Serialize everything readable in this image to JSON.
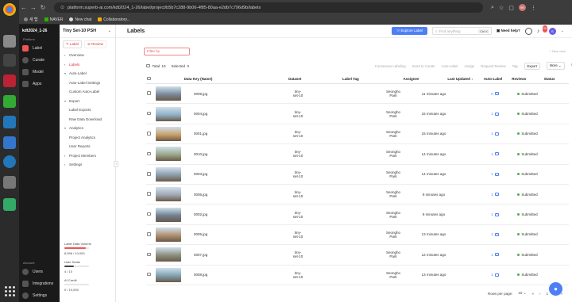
{
  "browser": {
    "url": "platform.superb-ai.com/kdt2024_1-26/label/project/b5b7c288-9b06-4f85-80aa-e2db7c796d9b/labels",
    "bookmarks": [
      "새 탭",
      "NAVER",
      "New chat",
      "Collaboratory..."
    ],
    "avatar": "99"
  },
  "appnav": {
    "workspace": "kdt2024_1-26",
    "platform_section": "Platform",
    "items": [
      "Label",
      "Curate",
      "Model",
      "Apps"
    ],
    "account_section": "Account",
    "bottom_items": [
      "Users",
      "Integrations",
      "Settings"
    ]
  },
  "project": {
    "name": "Tiny Set-10 PSH",
    "tabs": [
      "Label",
      "Review"
    ],
    "menu": [
      {
        "label": "Overview",
        "type": "item"
      },
      {
        "label": "Labels",
        "type": "item",
        "active": true
      },
      {
        "label": "Auto-Label",
        "type": "group"
      },
      {
        "label": "Auto-Label Settings",
        "type": "sub"
      },
      {
        "label": "Custom Auto-Label",
        "type": "sub"
      },
      {
        "label": "Export",
        "type": "group"
      },
      {
        "label": "Label Exports",
        "type": "sub"
      },
      {
        "label": "Raw Data Download",
        "type": "sub"
      },
      {
        "label": "Analytics",
        "type": "group"
      },
      {
        "label": "Project Analytics",
        "type": "sub"
      },
      {
        "label": "User Reports",
        "type": "sub"
      },
      {
        "label": "Project Members",
        "type": "item"
      },
      {
        "label": "Settings",
        "type": "item"
      }
    ],
    "quota": {
      "label_data_volume_title": "Label Data Volume",
      "label_data_volume_value": "8,596 / 10,000",
      "label_data_volume_fraction": 0.86,
      "user_seats_title": "User Seats",
      "user_seats_value": "4 / 10",
      "user_seats_fraction": 0.4,
      "ai_credit_title": "AI Credit",
      "ai_credit_value": "0 / 10,000",
      "ai_credit_fraction": 0
    }
  },
  "main": {
    "title": "Labels",
    "explore_button": "Explore Label",
    "find_placeholder": "Find anything",
    "find_shortcut": "Ctrl K",
    "need_help": "Need help?",
    "notification_count": "99",
    "user_initial": "S",
    "filter_placeholder": "Filter by",
    "new_view": "+ New view",
    "total_label": "Total",
    "total_value": "10",
    "selected_label": "Selected",
    "selected_value": "0",
    "actions": [
      "Consensus Labeling",
      "Send to Curate",
      "Auto-Label",
      "Assign",
      "Request Review",
      "Tag",
      "Export",
      "More"
    ],
    "columns": [
      "Data Key (Name)",
      "Dataset",
      "Label Tag",
      "Assignee",
      "Last Updated",
      "Auto-Label",
      "Reviews",
      "Status"
    ],
    "rows": [
      {
        "key": "0009.jpg",
        "dataset": "tiny-set-10",
        "assignee": "Seongho Park",
        "updated": "11 minutes ago",
        "reviews": "0",
        "status": "Submitted",
        "thumb": "#7a8a9a"
      },
      {
        "key": "0004.jpg",
        "dataset": "tiny-set-10",
        "assignee": "Seongho Park",
        "updated": "15 minutes ago",
        "reviews": "1",
        "status": "Submitted",
        "thumb": "#8fb0c8"
      },
      {
        "key": "0001.jpg",
        "dataset": "tiny-set-10",
        "assignee": "Seongho Park",
        "updated": "15 minutes ago",
        "reviews": "1",
        "status": "Submitted",
        "thumb": "#c9a06a"
      },
      {
        "key": "0010.jpg",
        "dataset": "tiny-set-10",
        "assignee": "Seongho Park",
        "updated": "14 minutes ago",
        "reviews": "1",
        "status": "Submitted",
        "thumb": "#9aa88a"
      },
      {
        "key": "0003.jpg",
        "dataset": "tiny-set-10",
        "assignee": "Seongho Park",
        "updated": "14 minutes ago",
        "reviews": "1",
        "status": "Submitted",
        "thumb": "#8a9aa8"
      },
      {
        "key": "0006.jpg",
        "dataset": "tiny-set-10",
        "assignee": "Seongho Park",
        "updated": "9 minutes ago",
        "reviews": "1",
        "status": "Submitted",
        "thumb": "#a0a8b4"
      },
      {
        "key": "0002.jpg",
        "dataset": "tiny-set-10",
        "assignee": "Seongho Park",
        "updated": "9 minutes ago",
        "reviews": "1",
        "status": "Submitted",
        "thumb": "#6f8090"
      },
      {
        "key": "0005.jpg",
        "dataset": "tiny-set-10",
        "assignee": "Seongho Park",
        "updated": "13 minutes ago",
        "reviews": "1",
        "status": "Submitted",
        "thumb": "#b09070"
      },
      {
        "key": "0007.jpg",
        "dataset": "tiny-set-10",
        "assignee": "Seongho Park",
        "updated": "12 minutes ago",
        "reviews": "1",
        "status": "Submitted",
        "thumb": "#8c8f80"
      },
      {
        "key": "0008.jpg",
        "dataset": "tiny-set-10",
        "assignee": "Seongho Park",
        "updated": "13 minutes ago",
        "reviews": "1",
        "status": "Submitted",
        "thumb": "#7fa0b0"
      }
    ],
    "pager": {
      "rows_per_page_label": "Rows per page:",
      "rows_per_page": "10",
      "current_page": "1"
    }
  },
  "colors": {
    "accent": "#4e7ff5",
    "brand_red": "#dd3333",
    "status_green": "#4caf50"
  }
}
